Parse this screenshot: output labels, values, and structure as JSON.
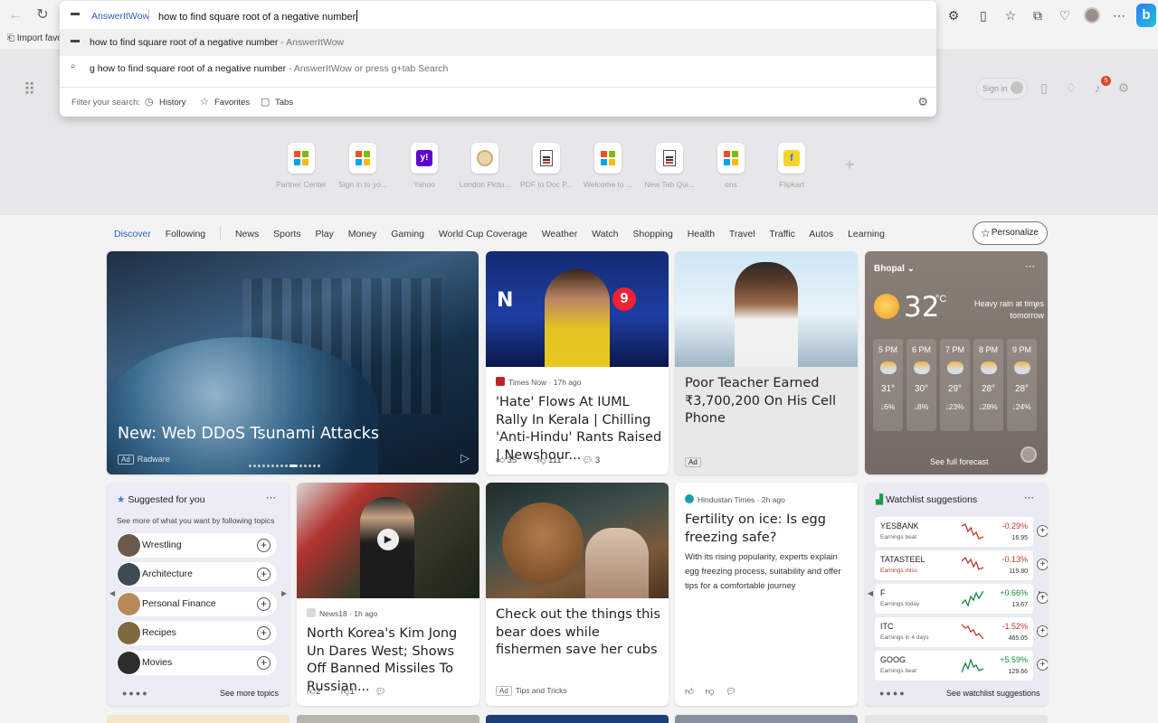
{
  "browser": {
    "favorites_bar": {
      "import_label": "Import favo"
    }
  },
  "omnibox": {
    "engine": "AnswerItWow",
    "query": "how to find square root of a negative number",
    "suggestions": [
      {
        "text": "how to find square root of a negative number",
        "suffix": " - AnswerItWow"
      },
      {
        "text": "g how to find square root of a negative number",
        "suffix": " - AnswerItWow or press g+tab Search"
      }
    ],
    "filter_label": "Filter your search:",
    "filters": [
      "History",
      "Favorites",
      "Tabs"
    ]
  },
  "ntp": {
    "signin_label": "Sign in",
    "notification_count": "5",
    "quick_links": [
      {
        "label": "Partner Center",
        "icon": "microsoft-logo"
      },
      {
        "label": "Sign in to yo...",
        "icon": "microsoft-logo"
      },
      {
        "label": "Yahoo",
        "icon": "yahoo-logo"
      },
      {
        "label": "London Pictu...",
        "icon": "seal-logo"
      },
      {
        "label": "PDF to Doc P...",
        "icon": "document-logo"
      },
      {
        "label": "Welcome to ...",
        "icon": "microsoft-logo"
      },
      {
        "label": "New Tab Qui...",
        "icon": "document-logo"
      },
      {
        "label": "ons",
        "icon": "microsoft-logo"
      },
      {
        "label": "Flipkart",
        "icon": "flipkart-logo"
      }
    ]
  },
  "feed": {
    "tabs": [
      "Discover",
      "Following",
      "News",
      "Sports",
      "Play",
      "Money",
      "Gaming",
      "World Cup Coverage",
      "Weather",
      "Watch",
      "Shopping",
      "Health",
      "Travel",
      "Traffic",
      "Autos",
      "Learning"
    ],
    "personalize_label": "Personalize",
    "hero": {
      "title": "New: Web DDoS Tsunami Attacks",
      "ad": "Ad",
      "sponsor": "Radware"
    },
    "news1": {
      "source": "Times Now · 17h ago",
      "headline": "'Hate' Flows At IUML Rally In Kerala | Chilling 'Anti-Hindu' Rants Raised | Newshour...",
      "likes": "35",
      "dislikes": "111",
      "comments": "3"
    },
    "ad_card": {
      "headline": "Poor Teacher Earned ₹3,700,200 On His Cell Phone",
      "ad": "Ad"
    },
    "weather": {
      "location": "Bhopal",
      "temp": "32",
      "unit": "°C",
      "condition": "Heavy rain at times tomorrow",
      "hours": [
        {
          "time": "5 PM",
          "temp": "31°",
          "precip": "6%"
        },
        {
          "time": "6 PM",
          "temp": "30°",
          "precip": "8%"
        },
        {
          "time": "7 PM",
          "temp": "29°",
          "precip": "23%"
        },
        {
          "time": "8 PM",
          "temp": "28°",
          "precip": "28%"
        },
        {
          "time": "9 PM",
          "temp": "28°",
          "precip": "24%"
        }
      ],
      "see_full": "See full forecast"
    },
    "suggested": {
      "title": "Suggested for you",
      "subtitle": "See more of what you want by following topics",
      "topics": [
        "Wrestling",
        "Architecture",
        "Personal Finance",
        "Recipes",
        "Movies"
      ],
      "see_more": "See more topics"
    },
    "news2": {
      "source": "News18 · 1h ago",
      "headline": "North Korea's Kim Jong Un Dares West; Shows Off Banned Missiles To Russian...",
      "likes": "2",
      "dislikes": "1"
    },
    "bear": {
      "headline": "Check out the things this bear does while fishermen save her cubs",
      "ad": "Ad",
      "sponsor": "Tips and Tricks"
    },
    "hindustan": {
      "source": "Hindustan Times · 2h ago",
      "headline": "Fertility on ice: Is egg freezing safe?",
      "description": "With its rising popularity, experts explain egg freezing process, suitability and offer tips for a comfortable journey"
    },
    "watchlist": {
      "title": "Watchlist suggestions",
      "stocks": [
        {
          "symbol": "YESBANK",
          "note": "Earnings beat",
          "change": "-0.29%",
          "price": "16.95",
          "dir": "down"
        },
        {
          "symbol": "TATASTEEL",
          "note": "Earnings miss",
          "change": "-0.13%",
          "price": "119.80",
          "dir": "down"
        },
        {
          "symbol": "F",
          "note": "Earnings today",
          "change": "+0.66%",
          "price": "13.67",
          "dir": "up"
        },
        {
          "symbol": "ITC",
          "note": "Earnings in 4 days",
          "change": "-1.52%",
          "price": "465.05",
          "dir": "down"
        },
        {
          "symbol": "GOOG",
          "note": "Earnings beat",
          "change": "+5.59%",
          "price": "129.66",
          "dir": "up"
        }
      ],
      "see_more": "See watchlist suggestions"
    }
  }
}
